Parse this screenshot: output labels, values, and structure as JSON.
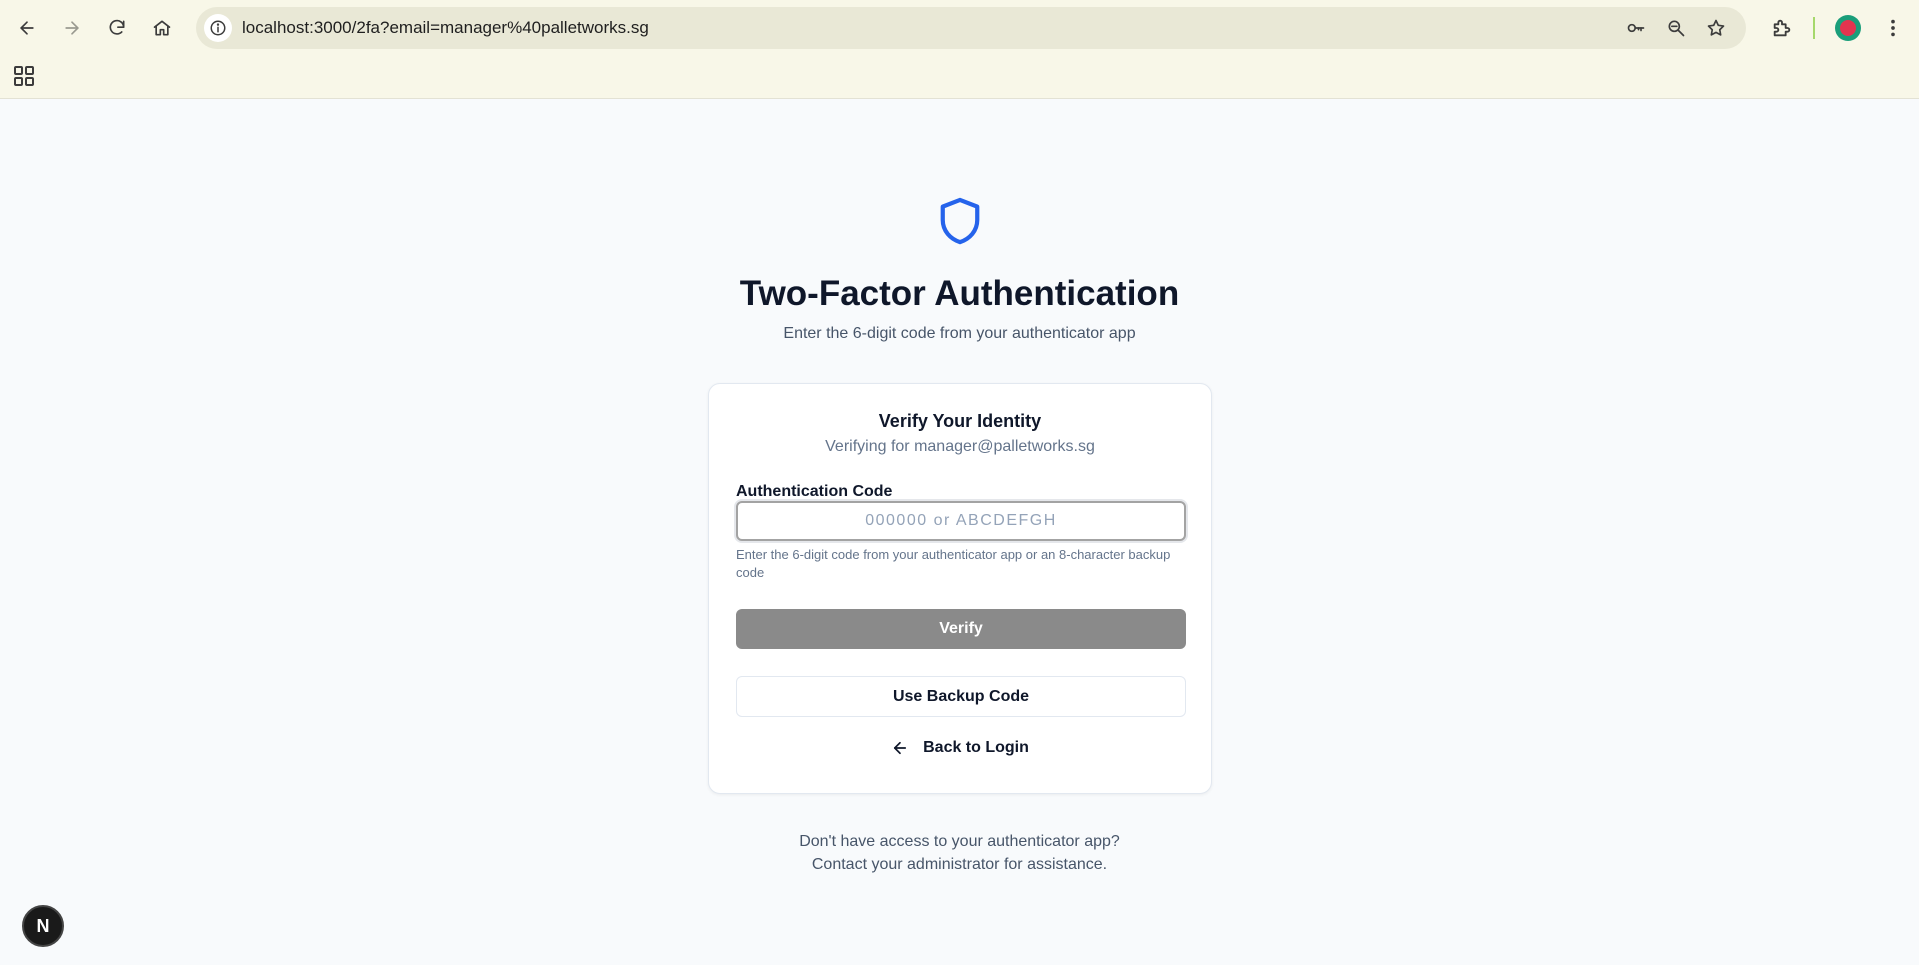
{
  "browser": {
    "url": "localhost:3000/2fa?email=manager%40palletworks.sg",
    "icons": [
      "back-icon",
      "forward-icon",
      "reload-icon",
      "home-icon",
      "site-info-icon",
      "password-key-icon",
      "zoom-icon",
      "bookmark-star-icon",
      "extensions-icon",
      "profile-avatar",
      "menu-icon",
      "apps-grid-icon"
    ]
  },
  "page": {
    "icon": "shield-icon",
    "accent_color": "#2563eb",
    "title": "Two-Factor Authentication",
    "subtitle": "Enter the 6-digit code from your authenticator app"
  },
  "card": {
    "title": "Verify Your Identity",
    "subtitle": "Verifying for manager@palletworks.sg",
    "code_label": "Authentication Code",
    "code_value": "",
    "code_placeholder": "000000 or ABCDEFGH",
    "help_text": "Enter the 6-digit code from your authenticator app or an 8-character backup code",
    "verify_label": "Verify",
    "backup_label": "Use Backup Code",
    "back_label": "Back to Login"
  },
  "footer": {
    "line1": "Don't have access to your authenticator app?",
    "line2": "Contact your administrator for assistance."
  },
  "dev_badge": {
    "label": "N"
  }
}
